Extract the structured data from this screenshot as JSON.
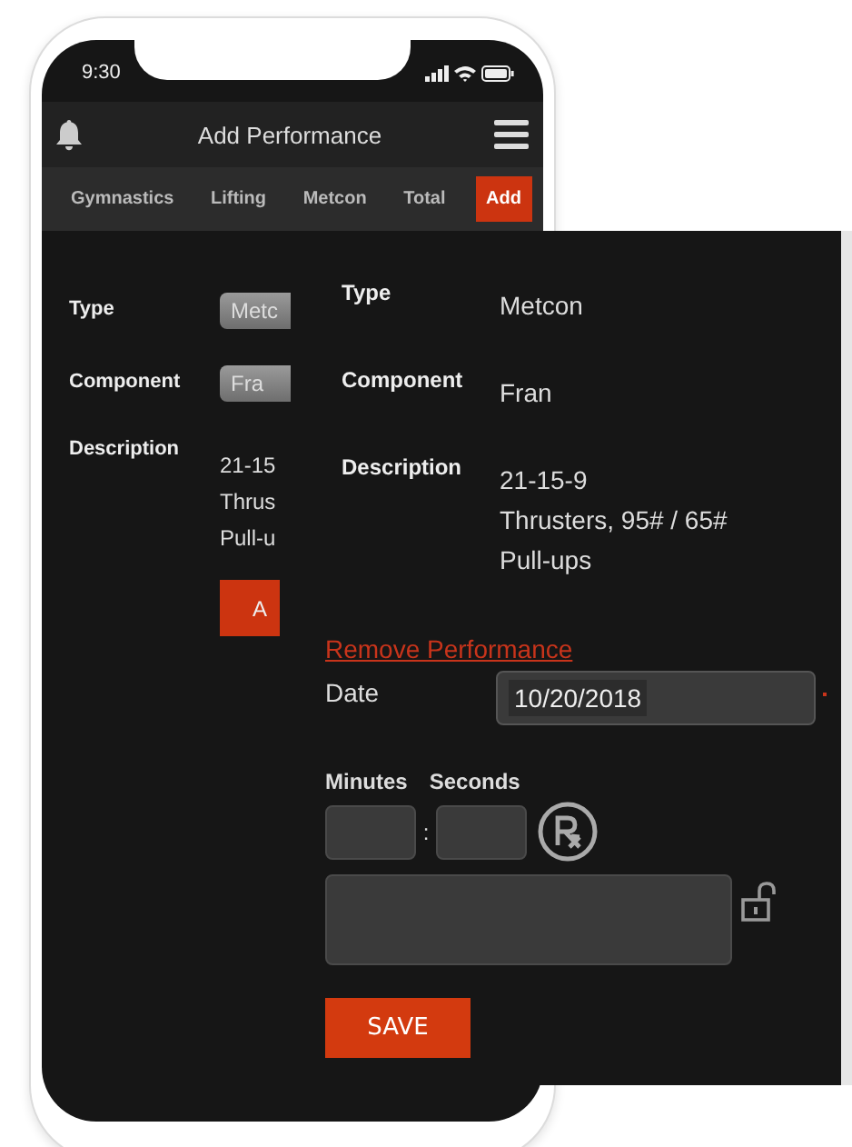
{
  "status_bar": {
    "time": "9:30"
  },
  "header": {
    "title": "Add Performance"
  },
  "tabs": [
    {
      "label": "Gymnastics",
      "selected": false
    },
    {
      "label": "Lifting",
      "selected": false
    },
    {
      "label": "Metcon",
      "selected": false
    },
    {
      "label": "Total",
      "selected": false
    },
    {
      "label": "Add",
      "selected": true
    }
  ],
  "background_form": {
    "fields": [
      {
        "label": "Type",
        "value": "Metc"
      },
      {
        "label": "Component",
        "value": "Fra"
      }
    ],
    "description_label": "Description",
    "description_lines": [
      "21-15",
      "Thrus",
      "Pull-u"
    ],
    "button": "A"
  },
  "panel": {
    "details": [
      {
        "label": "Type",
        "lines": [
          "Metcon"
        ]
      },
      {
        "label": "Component",
        "lines": [
          "Fran"
        ]
      },
      {
        "label": "Description",
        "lines": [
          "21-15-9",
          "Thrusters, 95# / 65#",
          "Pull-ups"
        ]
      }
    ],
    "remove_link": "Remove Performance",
    "date": {
      "label": "Date",
      "value": "10/20/2018",
      "required": true
    },
    "time": {
      "minutes_label": "Minutes",
      "seconds_label": "Seconds",
      "separator": ":"
    },
    "save_button": "SAVE"
  }
}
